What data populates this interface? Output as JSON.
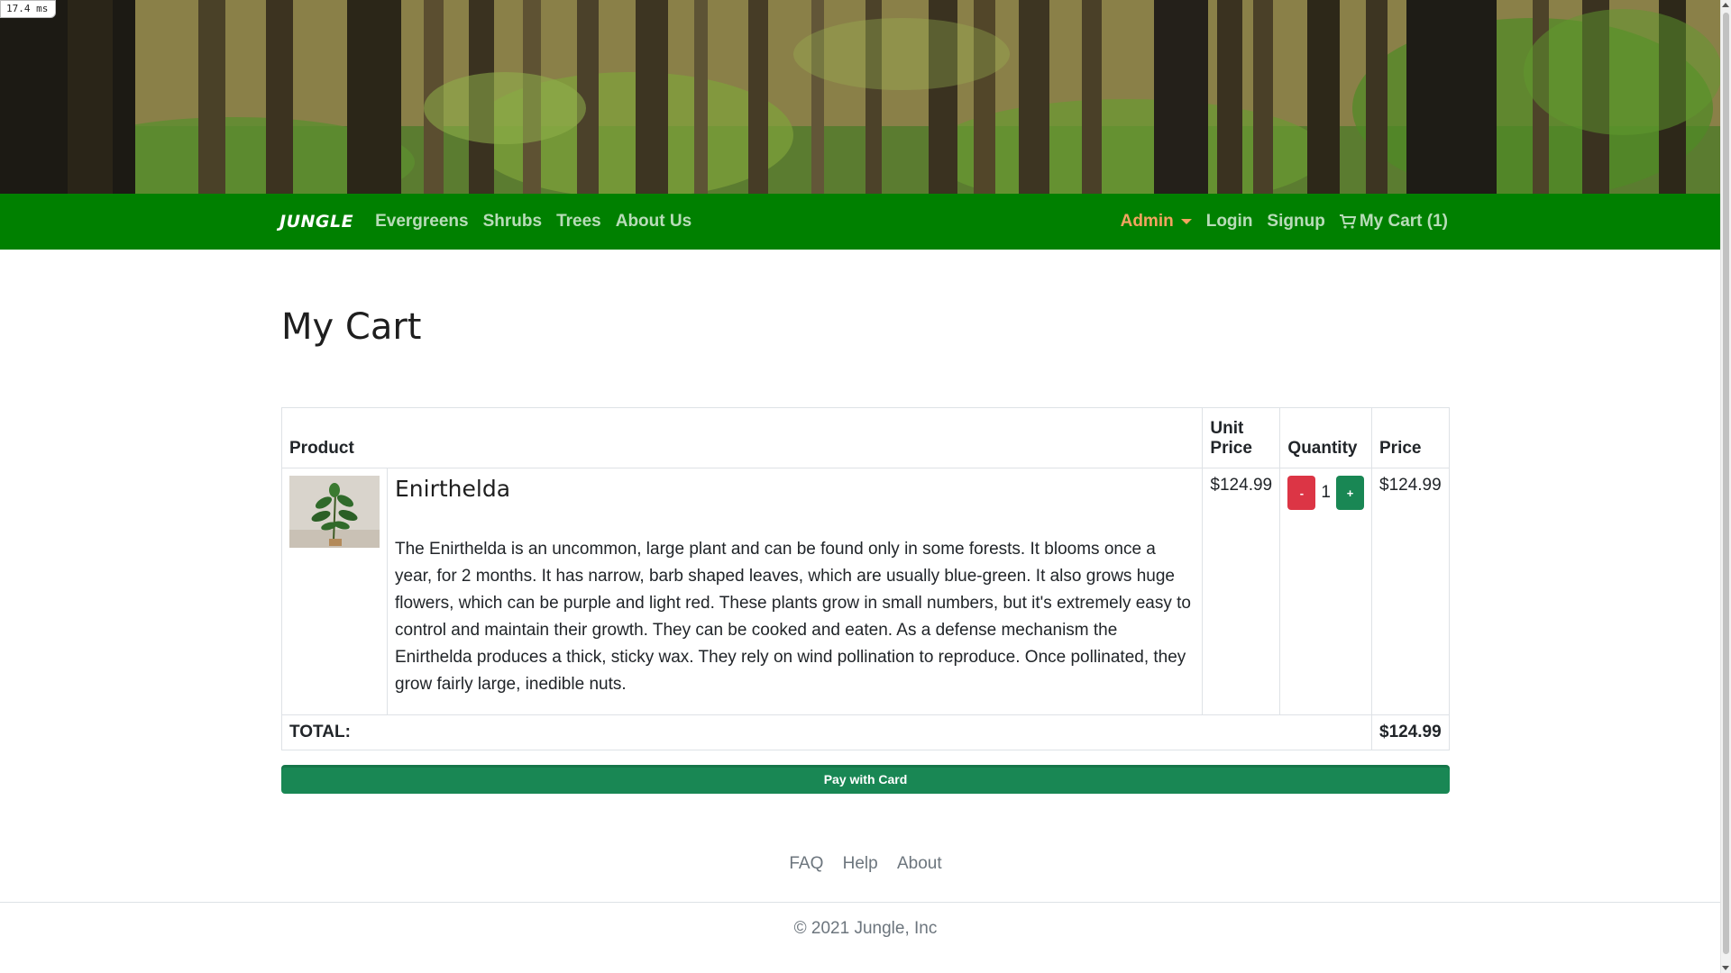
{
  "timer": "17.4 ms",
  "nav": {
    "brand": "JUNGLE",
    "links": [
      "Evergreens",
      "Shrubs",
      "Trees",
      "About Us"
    ],
    "admin": "Admin",
    "login": "Login",
    "signup": "Signup",
    "cart": "My Cart (1)"
  },
  "page": {
    "title": "My Cart"
  },
  "table": {
    "headers": {
      "product": "Product",
      "unit_price": "Unit Price",
      "quantity": "Quantity",
      "price": "Price"
    },
    "items": [
      {
        "name": "Enirthelda",
        "description": "The Enirthelda is an uncommon, large plant and can be found only in some forests. It blooms once a year, for 2 months. It has narrow, barb shaped leaves, which are usually blue-green. It also grows huge flowers, which can be purple and light red. These plants grow in small numbers, but it's extremely easy to control and maintain their growth. They can be cooked and eaten. As a defense mechanism the Enirthelda produces a thick, sticky wax. They rely on wind pollination to reproduce. Once pollinated, they grow fairly large, inedible nuts.",
        "unit_price": "$124.99",
        "quantity": "1",
        "minus": "-",
        "plus": "+",
        "price": "$124.99"
      }
    ],
    "total_label": "TOTAL:",
    "total_value": "$124.99"
  },
  "pay_button": "Pay with Card",
  "footer": {
    "links": [
      "FAQ",
      "Help",
      "About"
    ],
    "copyright": "© 2021 Jungle, Inc"
  },
  "colors": {
    "navbar": "#008000",
    "admin": "#f4a460",
    "danger": "#dc3545",
    "success": "#198754"
  },
  "icons": {
    "cart": "cart-icon",
    "caret": "chevron-down-icon"
  }
}
